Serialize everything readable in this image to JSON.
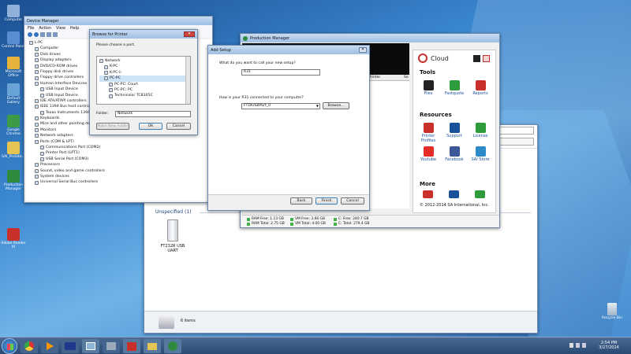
{
  "desktop": {
    "icons": [
      {
        "label": "Computer",
        "color": "#8fb0d8"
      },
      {
        "label": "Control Panel",
        "color": "#5b8ed0"
      },
      {
        "label": "Microsoft Office",
        "color": "#e8b33a"
      },
      {
        "label": "Default Gallery",
        "color": "#6aa3d8"
      },
      {
        "label": "Google Chrome",
        "color": "#3c9b47"
      },
      {
        "label": "SAI_ProSite...",
        "color": "#e6c453"
      },
      {
        "label": "Production Manager",
        "color": "#2e8b3e"
      },
      {
        "label": "Adobe Reader XI",
        "color": "#c9302c"
      }
    ],
    "recycle_bin": "Recycle Bin"
  },
  "device_manager": {
    "title": "Device Manager",
    "menu": [
      "File",
      "Action",
      "View",
      "Help"
    ],
    "tree": [
      {
        "text": "L-PC",
        "indent": 0
      },
      {
        "text": "Computer",
        "indent": 1
      },
      {
        "text": "Disk drives",
        "indent": 1
      },
      {
        "text": "Display adapters",
        "indent": 1
      },
      {
        "text": "DVD/CD-ROM drives",
        "indent": 1
      },
      {
        "text": "Floppy disk drives",
        "indent": 1
      },
      {
        "text": "Floppy drive controllers",
        "indent": 1
      },
      {
        "text": "Human Interface Devices",
        "indent": 1
      },
      {
        "text": "USB Input Device",
        "indent": 2
      },
      {
        "text": "USB Input Device",
        "indent": 2
      },
      {
        "text": "IDE ATA/ATAPI controllers",
        "indent": 1
      },
      {
        "text": "IEEE 1394 Bus host controllers",
        "indent": 1
      },
      {
        "text": "Texas Instruments 1394...",
        "indent": 2
      },
      {
        "text": "Keyboards",
        "indent": 1
      },
      {
        "text": "Mice and other pointing devices",
        "indent": 1
      },
      {
        "text": "Monitors",
        "indent": 1
      },
      {
        "text": "Network adapters",
        "indent": 1
      },
      {
        "text": "Ports (COM & LPT)",
        "indent": 1
      },
      {
        "text": "Communications Port (COM2)",
        "indent": 2
      },
      {
        "text": "Printer Port (LPT1)",
        "indent": 2
      },
      {
        "text": "USB Serial Port (COM3)",
        "indent": 2
      },
      {
        "text": "Processors",
        "indent": 1
      },
      {
        "text": "Sound, video and game controllers",
        "indent": 1
      },
      {
        "text": "System devices",
        "indent": 1
      },
      {
        "text": "Universal Serial Bus controllers",
        "indent": 1
      }
    ]
  },
  "browse_printer": {
    "title": "Browse for Printer",
    "prompt": "Please choose a port.",
    "tree": [
      {
        "text": "Network",
        "indent": 0
      },
      {
        "text": "K-PC",
        "indent": 1
      },
      {
        "text": "K-PC-ii",
        "indent": 1
      },
      {
        "text": "PC-PC",
        "indent": 1
      },
      {
        "text": "PC-PC: Court",
        "indent": 2
      },
      {
        "text": "PC-PC: PC",
        "indent": 2
      },
      {
        "text": "Technicolor TC8305C",
        "indent": 2
      }
    ],
    "folder_label": "Folder:",
    "folder_value": "Network",
    "make_folder": "Make New Folder",
    "ok": "OK",
    "cancel": "Cancel"
  },
  "production_manager": {
    "title": "Production Manager",
    "col_hdr1": "Printer",
    "col_hdr2": "Se",
    "status": [
      {
        "text": "RAM Free: 1.13 GB",
        "color": "#3fb24a"
      },
      {
        "text": "RAM Total: 2.75 GB",
        "color": "#3fb24a"
      },
      {
        "text": "VM Free: 3.66 GB",
        "color": "#3fb24a"
      },
      {
        "text": "VM Total: 4.00 GB",
        "color": "#3fb24a"
      },
      {
        "text": "C: Free: 240.7 GB",
        "color": "#3fb24a"
      },
      {
        "text": "C: Total: 279.4 GB",
        "color": "#3fb24a"
      }
    ]
  },
  "add_setup": {
    "title": "Add Setup",
    "q1": "What do you want to call your new setup?",
    "name_value": "R31",
    "q2": "How is your R31 connected to your computer?",
    "port_value": "FTDIUSBPort_0",
    "browse": "Browse...",
    "back": "Back",
    "finish": "Finish",
    "cancel": "Cancel"
  },
  "cloud": {
    "header": "Cloud",
    "tools_title": "Tools",
    "tools": [
      {
        "label": "Files",
        "color": "#222222"
      },
      {
        "label": "Fastquote",
        "color": "#2e9c3c"
      },
      {
        "label": "Reports",
        "color": "#c9302c"
      }
    ],
    "resources_title": "Resources",
    "resources": [
      {
        "label": "Printer Profiles",
        "color": "#c9302c"
      },
      {
        "label": "Support",
        "color": "#1a4f9a"
      },
      {
        "label": "License",
        "color": "#2e9c3c"
      },
      {
        "label": "Youtube",
        "color": "#e52d27"
      },
      {
        "label": "Facebook",
        "color": "#3b5998"
      },
      {
        "label": "SAI Store",
        "color": "#2e8bc9"
      }
    ],
    "more_title": "More",
    "more_colors": [
      "#c9302c",
      "#1a4f9a",
      "#2e9c3c"
    ],
    "copyright": "© 2012-2014 SA International, Inc."
  },
  "explorer": {
    "group_title": "Unspecified (1)",
    "item_label": "FT232R USB UART",
    "status_count": "6 items"
  },
  "taskbar": {
    "time": "2:54 PM",
    "date": "3/27/2024"
  }
}
